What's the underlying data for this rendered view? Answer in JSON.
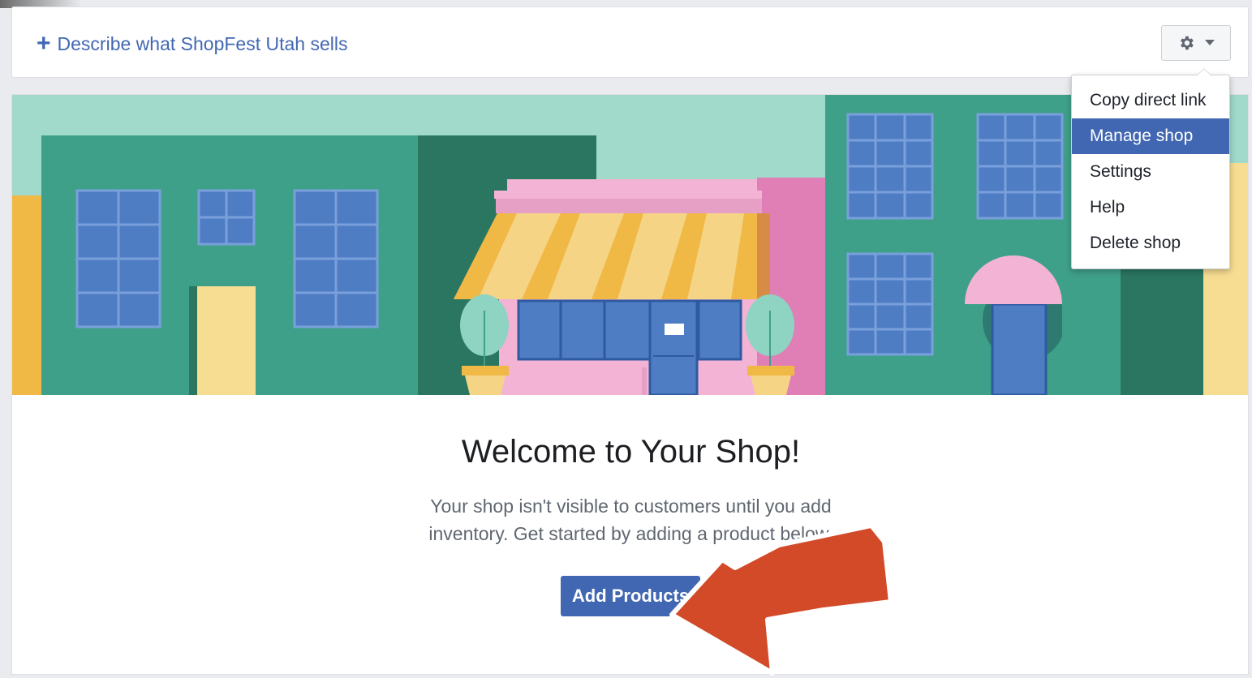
{
  "header": {
    "describe_link_icon": "plus-icon",
    "describe_link_label": "Describe what ShopFest Utah sells",
    "settings_button_icon": "gear-icon",
    "settings_button_dropdown_icon": "caret-down-icon"
  },
  "dropdown": {
    "items": [
      {
        "label": "Copy direct link"
      },
      {
        "label": "Manage shop"
      },
      {
        "label": "Settings"
      },
      {
        "label": "Help"
      },
      {
        "label": "Delete shop"
      }
    ],
    "active_index": 1
  },
  "main": {
    "welcome_title": "Welcome to Your Shop!",
    "description_line1": "Your shop isn't visible to customers until you add",
    "description_line2": "inventory. Get started by adding a product below.",
    "add_button_label": "Add Products"
  },
  "colors": {
    "accent": "#4267b2",
    "annotation_arrow": "#d24a28"
  }
}
